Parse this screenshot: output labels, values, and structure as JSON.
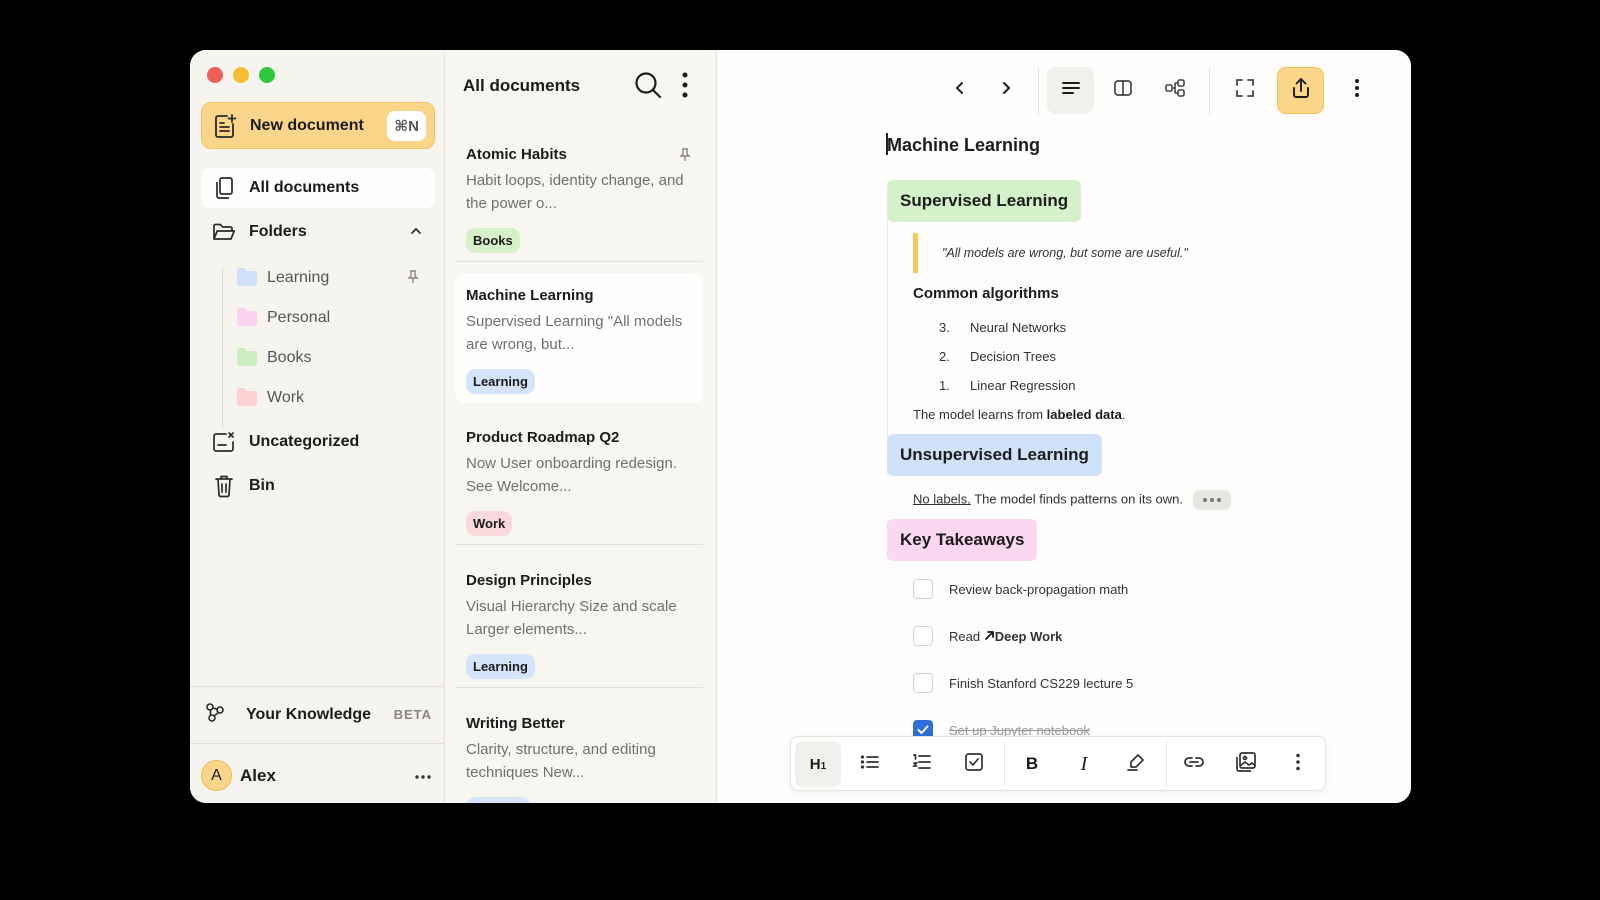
{
  "sidebar": {
    "new_document_label": "New document",
    "new_document_shortcut": "⌘N",
    "all_documents": "All documents",
    "folders_label": "Folders",
    "folders": [
      {
        "name": "Learning",
        "color": "#cfe0fb",
        "pinned": true
      },
      {
        "name": "Personal",
        "color": "#fbd3ef"
      },
      {
        "name": "Books",
        "color": "#cdeec0"
      },
      {
        "name": "Work",
        "color": "#fbd1d1"
      }
    ],
    "uncategorized": "Uncategorized",
    "bin": "Bin",
    "knowledge_label": "Your Knowledge",
    "knowledge_badge": "BETA",
    "user_initial": "A",
    "user_name": "Alex",
    "user_more": "···"
  },
  "doclist": {
    "title": "All documents",
    "docs": [
      {
        "title": "Atomic Habits",
        "snippet": "Habit loops, identity change, and the power o...",
        "tag": "Books",
        "tag_color": "#d6f0c8",
        "pinned": true
      },
      {
        "title": "Machine Learning",
        "snippet": "Supervised Learning \"All models are wrong, but...",
        "tag": "Learning",
        "tag_color": "#d4e4fb",
        "active": true
      },
      {
        "title": "Product Roadmap Q2",
        "snippet": "Now User onboarding redesign. See Welcome...",
        "tag": "Work",
        "tag_color": "#fbd9d9"
      },
      {
        "title": "Design Principles",
        "snippet": "Visual Hierarchy Size and scale Larger elements...",
        "tag": "Learning",
        "tag_color": "#d4e4fb"
      },
      {
        "title": "Writing Better",
        "snippet": "Clarity, structure, and editing techniques New...",
        "tag": "",
        "tag_color": "#d4e4fb"
      }
    ]
  },
  "editor": {
    "title": "Machine Learning",
    "sections": {
      "supervised": {
        "label": "Supervised Learning",
        "color": "#d3f2c9"
      },
      "unsupervised": {
        "label": "Unsupervised Learning",
        "color": "#cfe2fa"
      },
      "takeaways": {
        "label": "Key Takeaways",
        "color": "#fbd7f1"
      }
    },
    "quote": "\"All models are wrong, but some are useful.\"",
    "algorithms_heading": "Common algorithms",
    "algorithms": [
      {
        "num": "3.",
        "text": "Neural Networks"
      },
      {
        "num": "2.",
        "text": "Decision Trees"
      },
      {
        "num": "1.",
        "text": "Linear Regression"
      }
    ],
    "supervised_para_prefix": "The model learns from ",
    "supervised_para_bold": "labeled data",
    "supervised_para_suffix": ".",
    "unsupervised_link": "No labels.",
    "unsupervised_para": " The model finds patterns on its own.",
    "tasks": [
      {
        "text": "Review back-propagation math",
        "checked": false
      },
      {
        "prefix": "Read ",
        "link": "Deep Work",
        "checked": false
      },
      {
        "text": "Finish Stanford CS229 lecture 5",
        "checked": false
      },
      {
        "text": "Set up Jupyter notebook",
        "checked": true
      }
    ]
  },
  "format_bar": {
    "h1_label": "H",
    "h1_sub": "1",
    "bold": "B",
    "italic": "I"
  },
  "colors": {
    "accent": "#fbd68a",
    "check_blue": "#2f6fd6"
  }
}
